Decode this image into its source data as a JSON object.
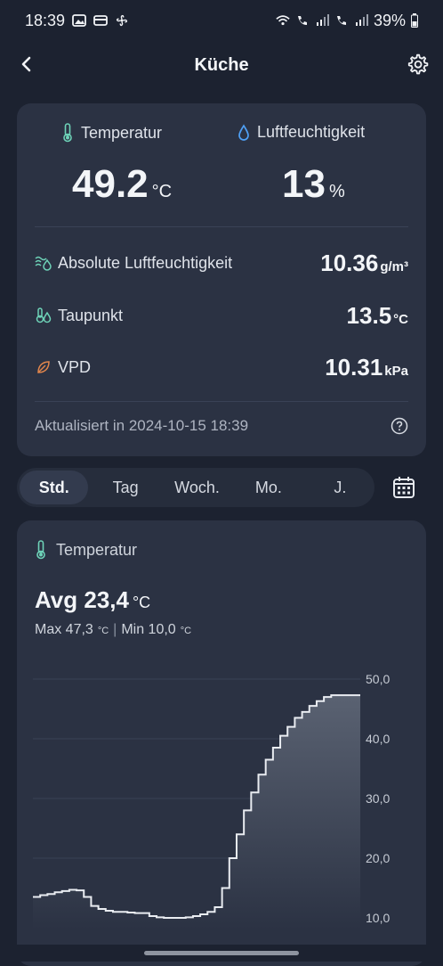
{
  "status_bar": {
    "time": "18:39",
    "battery": "39%",
    "left_icons": [
      "image-icon",
      "card-icon",
      "fan-icon"
    ],
    "right_icons": [
      "wifi-icon",
      "volte-call-icon",
      "signal-icon",
      "battery-icon"
    ]
  },
  "header": {
    "title": "Küche",
    "back_icon": "chevron-left-icon",
    "settings_icon": "gear-icon"
  },
  "summary": {
    "temperature": {
      "label": "Temperatur",
      "value": "49.2",
      "unit": "°C"
    },
    "humidity": {
      "label": "Luftfeuchtigkeit",
      "value": "13",
      "unit": "%"
    },
    "metrics": [
      {
        "label": "Absolute Luftfeuchtigkeit",
        "value": "10.36",
        "unit": "g/m³",
        "icon": "wave-drop-icon"
      },
      {
        "label": "Taupunkt",
        "value": "13.5",
        "unit": "°C",
        "icon": "dewpoint-icon"
      },
      {
        "label": "VPD",
        "value": "10.31",
        "unit": "kPa",
        "icon": "leaf-icon"
      }
    ],
    "updated": "Aktualisiert in 2024-10-15 18:39",
    "help_icon": "help-circle-icon"
  },
  "tabs": {
    "items": [
      "Std.",
      "Tag",
      "Woch.",
      "Mo.",
      "J."
    ],
    "active": "Std.",
    "calendar_icon": "calendar-icon"
  },
  "chart_card": {
    "title": "Temperatur",
    "avg_label": "Avg 23,4",
    "avg_unit": "°C",
    "max_label": "Max 47,3",
    "min_label": "Min 10,0",
    "unit": "°C",
    "separator": "|"
  },
  "chart_data": {
    "type": "area",
    "series": [
      {
        "values": [
          13.5,
          13.8,
          14.0,
          14.3,
          14.5,
          14.7,
          14.6,
          13.5,
          12.0,
          11.5,
          11.2,
          11.0,
          11.0,
          10.9,
          10.8,
          10.8,
          10.3,
          10.1,
          10.0,
          10.0,
          10.0,
          10.1,
          10.3,
          10.6,
          11.0,
          11.8,
          15.0,
          20.0,
          24.0,
          28.0,
          31.0,
          34.0,
          36.5,
          38.5,
          40.5,
          42.0,
          43.5,
          44.5,
          45.5,
          46.3,
          47.0,
          47.3,
          47.3,
          47.3,
          47.3,
          47.3
        ]
      }
    ],
    "yticks": [
      "50,0",
      "40,0",
      "30,0",
      "20,0",
      "10,0"
    ],
    "ylim": [
      8,
      50
    ],
    "grid": true,
    "colors": {
      "line": "#e9ecf1",
      "fill_top": "#5a6272",
      "fill_bottom": "#2b3243",
      "grid": "#3a4256"
    }
  }
}
